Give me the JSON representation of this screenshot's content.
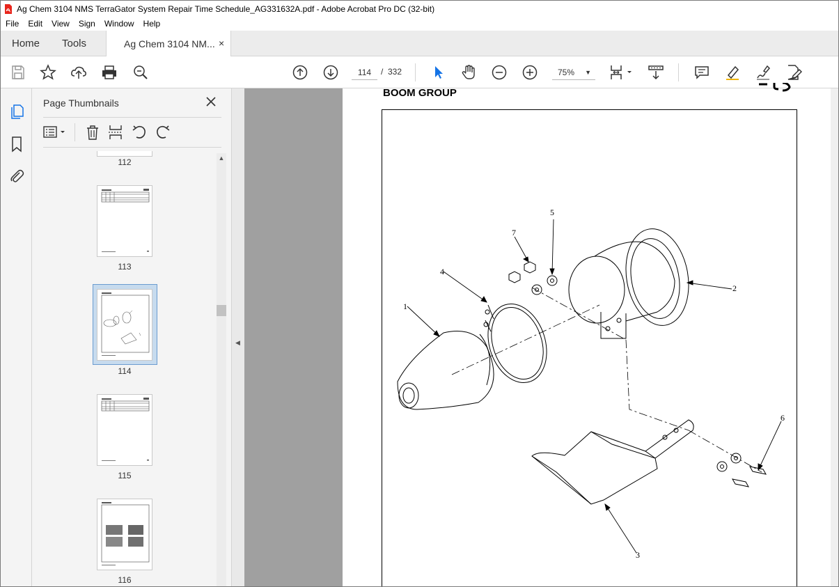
{
  "window": {
    "title": "Ag Chem 3104 NMS TerraGator System Repair Time Schedule_AG331632A.pdf - Adobe Acrobat Pro DC (32-bit)"
  },
  "menu": [
    "File",
    "Edit",
    "View",
    "Sign",
    "Window",
    "Help"
  ],
  "tabs": {
    "home": "Home",
    "tools": "Tools",
    "document": "Ag Chem 3104 NM...",
    "close": "×"
  },
  "toolbar": {
    "current_page": "114",
    "slash": "/",
    "total_pages": "332",
    "zoom": "75%",
    "zoom_caret": "▼",
    "icons": [
      "save-icon",
      "star-icon",
      "upload-icon",
      "print-icon",
      "find-zoom-icon",
      "page-up-icon",
      "page-down-icon",
      "select-arrow-icon",
      "hand-icon",
      "zoom-out-icon",
      "zoom-in-icon",
      "page-view-icon",
      "scroll-mode-icon",
      "comment-icon",
      "highlight-icon",
      "sign-icon",
      "edit-icon"
    ]
  },
  "panel": {
    "title": "Page Thumbnails",
    "thumbnails": [
      {
        "label": "112"
      },
      {
        "label": "113"
      },
      {
        "label": "114",
        "selected": true
      },
      {
        "label": "115"
      },
      {
        "label": "116"
      }
    ]
  },
  "page": {
    "heading": "BOOM GROUP",
    "callouts": [
      "1",
      "2",
      "3",
      "4",
      "5",
      "6",
      "7"
    ]
  },
  "colors": {
    "accent": "#1473e6",
    "doc_background": "#a0a0a0",
    "selected_thumb": "#c7dbee"
  }
}
